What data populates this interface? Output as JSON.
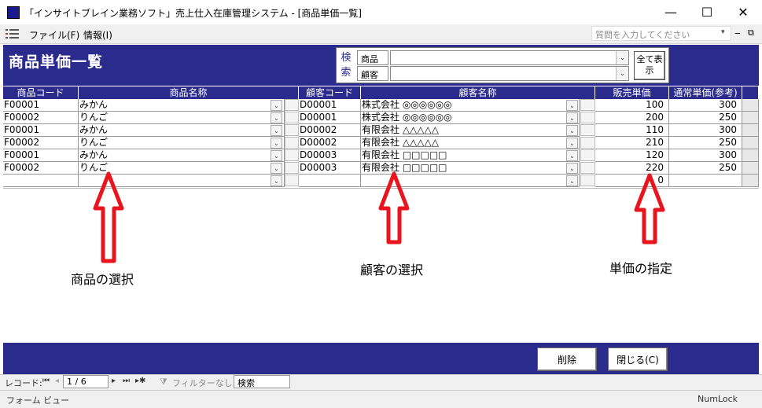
{
  "window": {
    "title": "「インサイトブレイン業務ソフト」売上仕入在庫管理システム - [商品単価一覧]",
    "minimize": "—",
    "maximize": "☐",
    "close": "✕"
  },
  "menu": {
    "file": "ファイル(F)",
    "info": "情報(I)",
    "help_placeholder": "質問を入力してください",
    "mdi_min": "‒",
    "mdi_restore": "⧉"
  },
  "header": {
    "title": "商品単価一覧",
    "search_label": "検索",
    "product_label": "商品",
    "customer_label": "顧客",
    "show_all": "全て表示"
  },
  "grid": {
    "columns": [
      "商品コード",
      "商品名称",
      "顧客コード",
      "顧客名称",
      "販売単価",
      "通常単価(参考)"
    ],
    "rows": [
      {
        "product_code": "F00001",
        "product_name": "みかん",
        "customer_code": "D00001",
        "customer_name": "株式会社 ◎◎◎◎◎◎",
        "price": "100",
        "standard_price": "300"
      },
      {
        "product_code": "F00002",
        "product_name": "りんご",
        "customer_code": "D00001",
        "customer_name": "株式会社 ◎◎◎◎◎◎",
        "price": "200",
        "standard_price": "250"
      },
      {
        "product_code": "F00001",
        "product_name": "みかん",
        "customer_code": "D00002",
        "customer_name": "有限会社 △△△△△",
        "price": "110",
        "standard_price": "300"
      },
      {
        "product_code": "F00002",
        "product_name": "りんご",
        "customer_code": "D00002",
        "customer_name": "有限会社 △△△△△",
        "price": "210",
        "standard_price": "250"
      },
      {
        "product_code": "F00001",
        "product_name": "みかん",
        "customer_code": "D00003",
        "customer_name": "有限会社 □□□□□",
        "price": "120",
        "standard_price": "300"
      },
      {
        "product_code": "F00002",
        "product_name": "りんご",
        "customer_code": "D00003",
        "customer_name": "有限会社 □□□□□",
        "price": "220",
        "standard_price": "250"
      },
      {
        "product_code": "",
        "product_name": "",
        "customer_code": "",
        "customer_name": "",
        "price": "0",
        "standard_price": ""
      }
    ]
  },
  "annotations": {
    "product": "商品の選択",
    "customer": "顧客の選択",
    "price": "単価の指定",
    "arrow_color": "#e8141e"
  },
  "footer": {
    "delete": "削除",
    "close": "閉じる(C)"
  },
  "nav": {
    "record_label": "レコード:",
    "position": "1 / 6",
    "filter": "フィルターなし",
    "search": "検索"
  },
  "status": {
    "left": "フォーム ビュー",
    "right": "NumLock"
  },
  "colors": {
    "header_bg": "#2b2b8e",
    "accent_red": "#e8141e"
  }
}
